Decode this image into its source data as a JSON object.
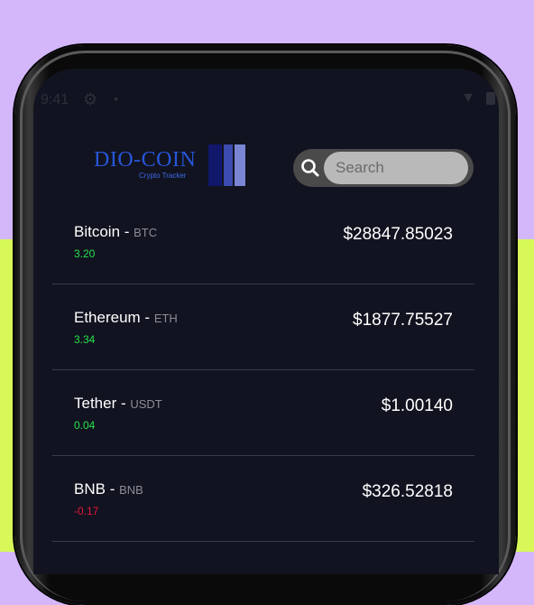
{
  "status_bar": {
    "time": "9:41"
  },
  "logo": {
    "title": "DIO-COIN",
    "subtitle": "Crypto Tracker"
  },
  "search": {
    "placeholder": "Search",
    "value": ""
  },
  "coins": [
    {
      "name": "Bitcoin",
      "symbol": "BTC",
      "change": "3.20",
      "price": "$28847.85023"
    },
    {
      "name": "Ethereum",
      "symbol": "ETH",
      "change": "3.34",
      "price": "$1877.75527"
    },
    {
      "name": "Tether",
      "symbol": "USDT",
      "change": "0.04",
      "price": "$1.00140"
    },
    {
      "name": "BNB",
      "symbol": "BNB",
      "change": "-0.17",
      "price": "$326.52818"
    }
  ],
  "colors": {
    "background_top": "#d4b7fb",
    "background_bottom": "#d8f85a",
    "screen": "#121320",
    "change_up": "#23e34a",
    "change_down": "#e8163b"
  },
  "icons": {
    "search": "search-icon",
    "settings": "gear-icon",
    "wifi": "wifi-icon",
    "battery": "battery-icon"
  }
}
